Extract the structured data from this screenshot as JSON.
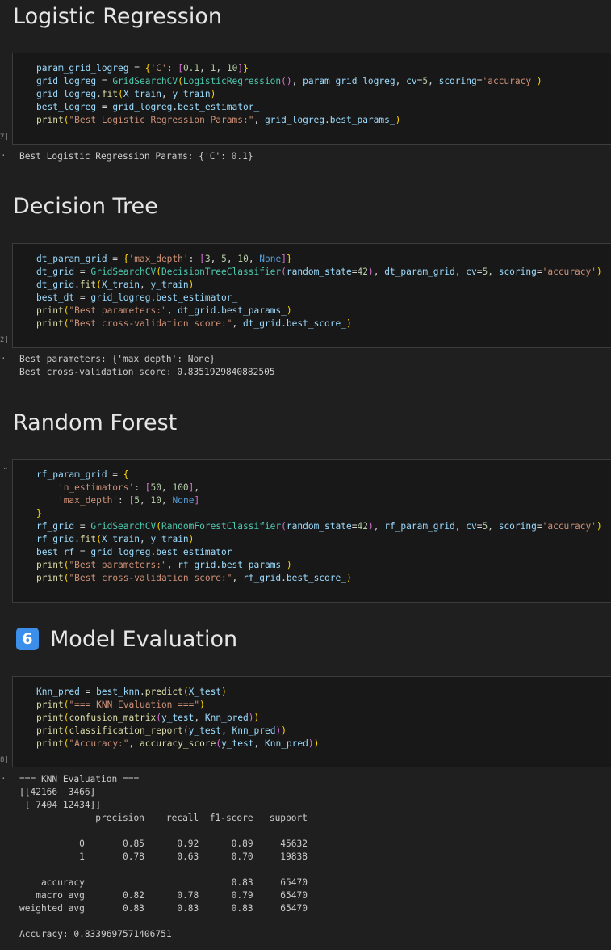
{
  "sections": {
    "logreg": {
      "heading": "Logistic Regression",
      "exec_count": "7]",
      "output": [
        "Best Logistic Regression Params: {'C': 0.1}"
      ]
    },
    "dt": {
      "heading": "Decision Tree",
      "exec_count": "2]",
      "output": [
        "Best parameters: {'max_depth': None}",
        "Best cross-validation score: 0.8351929840882505"
      ]
    },
    "rf": {
      "heading": "Random Forest"
    },
    "eval": {
      "badge": "6",
      "heading": "Model Evaluation",
      "exec_count": "8]",
      "output": [
        "=== KNN Evaluation ===",
        "[[42166  3466]",
        " [ 7404 12434]]",
        "              precision    recall  f1-score   support",
        "",
        "           0       0.85      0.92      0.89     45632",
        "           1       0.78      0.63      0.70     19838",
        "",
        "    accuracy                           0.83     65470",
        "   macro avg       0.82      0.78      0.79     65470",
        "weighted avg       0.83      0.83      0.83     65470",
        "",
        "Accuracy: 0.8339697571406751"
      ]
    }
  },
  "code_cells": {
    "logreg": [
      [
        [
          "v",
          "param_grid_logreg"
        ],
        [
          "o",
          " = "
        ],
        [
          "p",
          "{"
        ],
        [
          "s",
          "'C'"
        ],
        [
          "o",
          ": "
        ],
        [
          "q",
          "["
        ],
        [
          "n",
          "0.1"
        ],
        [
          "o",
          ", "
        ],
        [
          "n",
          "1"
        ],
        [
          "o",
          ", "
        ],
        [
          "n",
          "10"
        ],
        [
          "q",
          "]"
        ],
        [
          "p",
          "}"
        ]
      ],
      [
        [
          "v",
          "grid_logreg"
        ],
        [
          "o",
          " = "
        ],
        [
          "c",
          "GridSearchCV"
        ],
        [
          "p",
          "("
        ],
        [
          "c",
          "LogisticRegression"
        ],
        [
          "q",
          "()"
        ],
        [
          "o",
          ", "
        ],
        [
          "v",
          "param_grid_logreg"
        ],
        [
          "o",
          ", "
        ],
        [
          "v",
          "cv"
        ],
        [
          "o",
          "="
        ],
        [
          "n",
          "5"
        ],
        [
          "o",
          ", "
        ],
        [
          "v",
          "scoring"
        ],
        [
          "o",
          "="
        ],
        [
          "s",
          "'accuracy'"
        ],
        [
          "p",
          ")"
        ]
      ],
      [
        [
          "v",
          "grid_logreg"
        ],
        [
          "o",
          "."
        ],
        [
          "f",
          "fit"
        ],
        [
          "p",
          "("
        ],
        [
          "v",
          "X_train"
        ],
        [
          "o",
          ", "
        ],
        [
          "v",
          "y_train"
        ],
        [
          "p",
          ")"
        ]
      ],
      [
        [
          "v",
          "best_logreg"
        ],
        [
          "o",
          " = "
        ],
        [
          "v",
          "grid_logreg"
        ],
        [
          "o",
          "."
        ],
        [
          "v",
          "best_estimator_"
        ]
      ],
      [
        [
          "f",
          "print"
        ],
        [
          "p",
          "("
        ],
        [
          "s",
          "\"Best Logistic Regression Params:\""
        ],
        [
          "o",
          ", "
        ],
        [
          "v",
          "grid_logreg"
        ],
        [
          "o",
          "."
        ],
        [
          "v",
          "best_params_"
        ],
        [
          "p",
          ")"
        ]
      ]
    ],
    "dt": [
      [
        [
          "v",
          "dt_param_grid"
        ],
        [
          "o",
          " = "
        ],
        [
          "p",
          "{"
        ],
        [
          "s",
          "'max_depth'"
        ],
        [
          "o",
          ": "
        ],
        [
          "q",
          "["
        ],
        [
          "n",
          "3"
        ],
        [
          "o",
          ", "
        ],
        [
          "n",
          "5"
        ],
        [
          "o",
          ", "
        ],
        [
          "n",
          "10"
        ],
        [
          "o",
          ", "
        ],
        [
          "k",
          "None"
        ],
        [
          "q",
          "]"
        ],
        [
          "p",
          "}"
        ]
      ],
      [
        [
          "v",
          "dt_grid"
        ],
        [
          "o",
          " = "
        ],
        [
          "c",
          "GridSearchCV"
        ],
        [
          "p",
          "("
        ],
        [
          "c",
          "DecisionTreeClassifier"
        ],
        [
          "q",
          "("
        ],
        [
          "v",
          "random_state"
        ],
        [
          "o",
          "="
        ],
        [
          "n",
          "42"
        ],
        [
          "q",
          ")"
        ],
        [
          "o",
          ", "
        ],
        [
          "v",
          "dt_param_grid"
        ],
        [
          "o",
          ", "
        ],
        [
          "v",
          "cv"
        ],
        [
          "o",
          "="
        ],
        [
          "n",
          "5"
        ],
        [
          "o",
          ", "
        ],
        [
          "v",
          "scoring"
        ],
        [
          "o",
          "="
        ],
        [
          "s",
          "'accuracy'"
        ],
        [
          "p",
          ")"
        ]
      ],
      [
        [
          "v",
          "dt_grid"
        ],
        [
          "o",
          "."
        ],
        [
          "f",
          "fit"
        ],
        [
          "p",
          "("
        ],
        [
          "v",
          "X_train"
        ],
        [
          "o",
          ", "
        ],
        [
          "v",
          "y_train"
        ],
        [
          "p",
          ")"
        ]
      ],
      [
        [
          "v",
          "best_dt"
        ],
        [
          "o",
          " = "
        ],
        [
          "v",
          "grid_logreg"
        ],
        [
          "o",
          "."
        ],
        [
          "v",
          "best_estimator_"
        ]
      ],
      [
        [
          "f",
          "print"
        ],
        [
          "p",
          "("
        ],
        [
          "s",
          "\"Best parameters:\""
        ],
        [
          "o",
          ", "
        ],
        [
          "v",
          "dt_grid"
        ],
        [
          "o",
          "."
        ],
        [
          "v",
          "best_params_"
        ],
        [
          "p",
          ")"
        ]
      ],
      [
        [
          "f",
          "print"
        ],
        [
          "p",
          "("
        ],
        [
          "s",
          "\"Best cross-validation score:\""
        ],
        [
          "o",
          ", "
        ],
        [
          "v",
          "dt_grid"
        ],
        [
          "o",
          "."
        ],
        [
          "v",
          "best_score_"
        ],
        [
          "p",
          ")"
        ]
      ]
    ],
    "rf": [
      [
        [
          "v",
          "rf_param_grid"
        ],
        [
          "o",
          " = "
        ],
        [
          "p",
          "{"
        ]
      ],
      [
        [
          "o",
          "    "
        ],
        [
          "s",
          "'n_estimators'"
        ],
        [
          "o",
          ": "
        ],
        [
          "q",
          "["
        ],
        [
          "n",
          "50"
        ],
        [
          "o",
          ", "
        ],
        [
          "n",
          "100"
        ],
        [
          "q",
          "]"
        ],
        [
          "o",
          ","
        ]
      ],
      [
        [
          "o",
          "    "
        ],
        [
          "s",
          "'max_depth'"
        ],
        [
          "o",
          ": "
        ],
        [
          "q",
          "["
        ],
        [
          "n",
          "5"
        ],
        [
          "o",
          ", "
        ],
        [
          "n",
          "10"
        ],
        [
          "o",
          ", "
        ],
        [
          "k",
          "None"
        ],
        [
          "q",
          "]"
        ]
      ],
      [
        [
          "p",
          "}"
        ]
      ],
      [
        [
          "v",
          "rf_grid"
        ],
        [
          "o",
          " = "
        ],
        [
          "c",
          "GridSearchCV"
        ],
        [
          "p",
          "("
        ],
        [
          "c",
          "RandomForestClassifier"
        ],
        [
          "q",
          "("
        ],
        [
          "v",
          "random_state"
        ],
        [
          "o",
          "="
        ],
        [
          "n",
          "42"
        ],
        [
          "q",
          ")"
        ],
        [
          "o",
          ", "
        ],
        [
          "v",
          "rf_param_grid"
        ],
        [
          "o",
          ", "
        ],
        [
          "v",
          "cv"
        ],
        [
          "o",
          "="
        ],
        [
          "n",
          "5"
        ],
        [
          "o",
          ", "
        ],
        [
          "v",
          "scoring"
        ],
        [
          "o",
          "="
        ],
        [
          "s",
          "'accuracy'"
        ],
        [
          "p",
          ")"
        ]
      ],
      [
        [
          "v",
          "rf_grid"
        ],
        [
          "o",
          "."
        ],
        [
          "f",
          "fit"
        ],
        [
          "p",
          "("
        ],
        [
          "v",
          "X_train"
        ],
        [
          "o",
          ", "
        ],
        [
          "v",
          "y_train"
        ],
        [
          "p",
          ")"
        ]
      ],
      [
        [
          "v",
          "best_rf"
        ],
        [
          "o",
          " = "
        ],
        [
          "v",
          "grid_logreg"
        ],
        [
          "o",
          "."
        ],
        [
          "v",
          "best_estimator_"
        ]
      ],
      [
        [
          "f",
          "print"
        ],
        [
          "p",
          "("
        ],
        [
          "s",
          "\"Best parameters:\""
        ],
        [
          "o",
          ", "
        ],
        [
          "v",
          "rf_grid"
        ],
        [
          "o",
          "."
        ],
        [
          "v",
          "best_params_"
        ],
        [
          "p",
          ")"
        ]
      ],
      [
        [
          "f",
          "print"
        ],
        [
          "p",
          "("
        ],
        [
          "s",
          "\"Best cross-validation score:\""
        ],
        [
          "o",
          ", "
        ],
        [
          "v",
          "rf_grid"
        ],
        [
          "o",
          "."
        ],
        [
          "v",
          "best_score_"
        ],
        [
          "p",
          ")"
        ]
      ]
    ],
    "eval": [
      [
        [
          "v",
          "Knn_pred"
        ],
        [
          "o",
          " = "
        ],
        [
          "v",
          "best_knn"
        ],
        [
          "o",
          "."
        ],
        [
          "f",
          "predict"
        ],
        [
          "p",
          "("
        ],
        [
          "v",
          "X_test"
        ],
        [
          "p",
          ")"
        ]
      ],
      [
        [
          "f",
          "print"
        ],
        [
          "p",
          "("
        ],
        [
          "s",
          "\"=== KNN Evaluation ===\""
        ],
        [
          "p",
          ")"
        ]
      ],
      [
        [
          "f",
          "print"
        ],
        [
          "p",
          "("
        ],
        [
          "f",
          "confusion_matrix"
        ],
        [
          "q",
          "("
        ],
        [
          "v",
          "y_test"
        ],
        [
          "o",
          ", "
        ],
        [
          "v",
          "Knn_pred"
        ],
        [
          "q",
          ")"
        ],
        [
          "p",
          ")"
        ]
      ],
      [
        [
          "f",
          "print"
        ],
        [
          "p",
          "("
        ],
        [
          "f",
          "classification_report"
        ],
        [
          "q",
          "("
        ],
        [
          "v",
          "y_test"
        ],
        [
          "o",
          ", "
        ],
        [
          "v",
          "Knn_pred"
        ],
        [
          "q",
          ")"
        ],
        [
          "p",
          ")"
        ]
      ],
      [
        [
          "f",
          "print"
        ],
        [
          "p",
          "("
        ],
        [
          "s",
          "\"Accuracy:\""
        ],
        [
          "o",
          ", "
        ],
        [
          "f",
          "accuracy_score"
        ],
        [
          "q",
          "("
        ],
        [
          "v",
          "y_test"
        ],
        [
          "o",
          ", "
        ],
        [
          "v",
          "Knn_pred"
        ],
        [
          "q",
          ")"
        ],
        [
          "p",
          ")"
        ]
      ]
    ]
  }
}
